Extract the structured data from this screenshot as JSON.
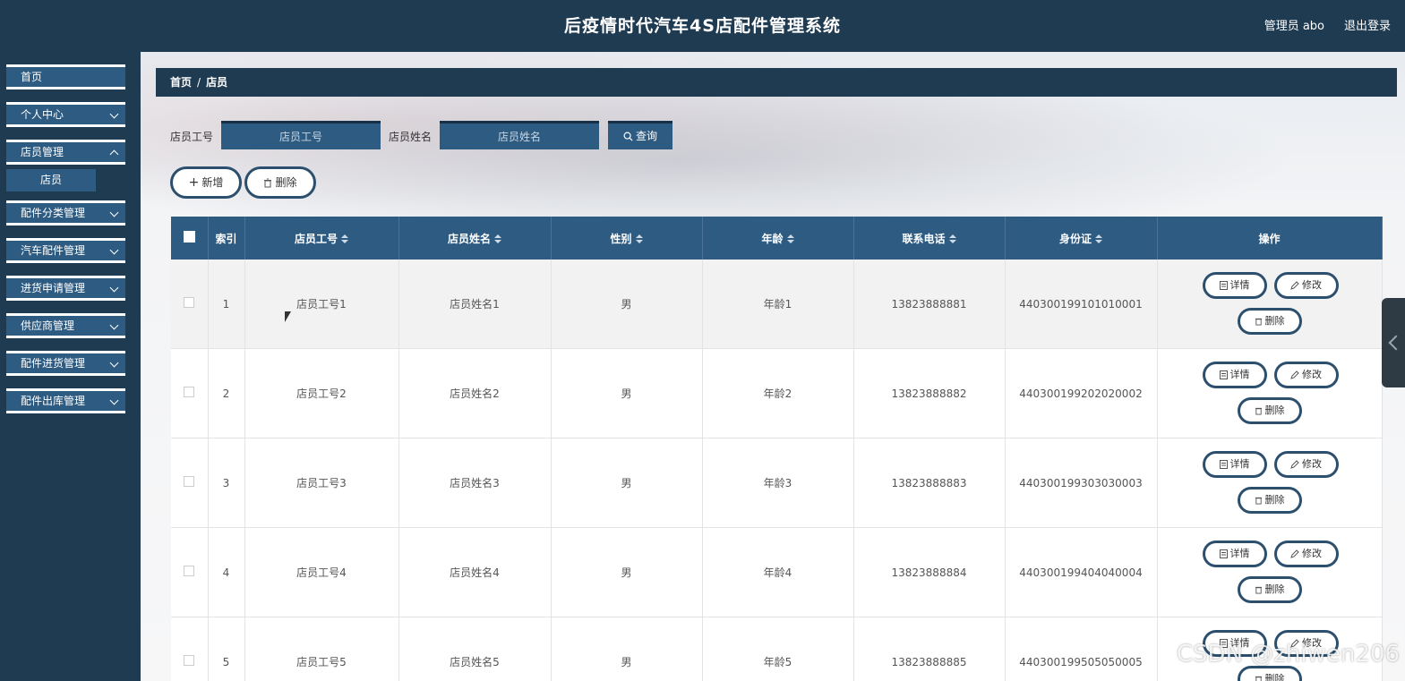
{
  "header": {
    "title": "后疫情时代汽车4S店配件管理系统",
    "user": "管理员 abo",
    "logout": "退出登录"
  },
  "sidebar": {
    "items": [
      {
        "label": "首页"
      },
      {
        "label": "个人中心"
      },
      {
        "label": "店员管理"
      },
      {
        "label": "配件分类管理"
      },
      {
        "label": "汽车配件管理"
      },
      {
        "label": "进货申请管理"
      },
      {
        "label": "供应商管理"
      },
      {
        "label": "配件进货管理"
      },
      {
        "label": "配件出库管理"
      }
    ],
    "sub_item": "店员"
  },
  "breadcrumb": {
    "home": "首页",
    "sep": "/",
    "current": "店员"
  },
  "search": {
    "id_label": "店员工号",
    "id_placeholder": "店员工号",
    "name_label": "店员姓名",
    "name_placeholder": "店员姓名",
    "query_button": "查询"
  },
  "actions": {
    "add": "新增",
    "delete": "删除"
  },
  "table": {
    "headers": [
      "索引",
      "店员工号",
      "店员姓名",
      "性别",
      "年龄",
      "联系电话",
      "身份证",
      "操作"
    ],
    "rows": [
      {
        "index": "1",
        "id": "店员工号1",
        "name": "店员姓名1",
        "gender": "男",
        "age": "年龄1",
        "phone": "13823888881",
        "idcard": "440300199101010001"
      },
      {
        "index": "2",
        "id": "店员工号2",
        "name": "店员姓名2",
        "gender": "男",
        "age": "年龄2",
        "phone": "13823888882",
        "idcard": "440300199202020002"
      },
      {
        "index": "3",
        "id": "店员工号3",
        "name": "店员姓名3",
        "gender": "男",
        "age": "年龄3",
        "phone": "13823888883",
        "idcard": "440300199303030003"
      },
      {
        "index": "4",
        "id": "店员工号4",
        "name": "店员姓名4",
        "gender": "男",
        "age": "年龄4",
        "phone": "13823888884",
        "idcard": "440300199404040004"
      },
      {
        "index": "5",
        "id": "店员工号5",
        "name": "店员姓名5",
        "gender": "男",
        "age": "年龄5",
        "phone": "13823888885",
        "idcard": "440300199505050005"
      }
    ],
    "row_actions": {
      "detail": "详情",
      "edit": "修改",
      "delete": "删除"
    }
  },
  "watermark": "CSDN @zhiwen206"
}
